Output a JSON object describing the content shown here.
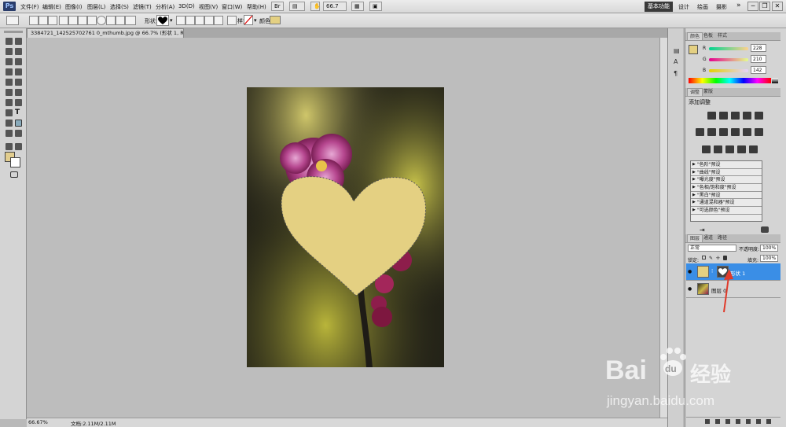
{
  "app": {
    "logo": "Ps"
  },
  "menu": {
    "items": [
      "文件(F)",
      "编辑(E)",
      "图像(I)",
      "图层(L)",
      "选择(S)",
      "滤镜(T)",
      "分析(A)",
      "3D(D)",
      "视图(V)",
      "窗口(W)",
      "帮助(H)"
    ],
    "zoom_value": "66.7"
  },
  "workspace": {
    "active": "基本功能",
    "links": [
      "设计",
      "绘画",
      "摄影"
    ],
    "more": "»",
    "window_controls": [
      "─",
      "❐",
      "✕"
    ]
  },
  "options": {
    "shape_label": "形状:",
    "shape_icon": "heart-shape",
    "style_label": "样式:",
    "color_label": "颜色:",
    "color_value": "#e4d082"
  },
  "document": {
    "tab_title": "3384721_142525702761 0_mthumb.jpg @ 66.7% (形状 1, RGB/8) *",
    "close": "×",
    "zoom": "66.67%",
    "size": "文档:2.11M/2.11M"
  },
  "tools": {
    "foreground": "#e2cd8e",
    "background": "#ffffff"
  },
  "color_panel": {
    "tabs": [
      "颜色",
      "色板",
      "样式"
    ],
    "swatch": "#e4d082",
    "channels": [
      {
        "label": "R",
        "value": "228"
      },
      {
        "label": "G",
        "value": "210"
      },
      {
        "label": "B",
        "value": "142"
      }
    ]
  },
  "adjustments_panel": {
    "tabs": [
      "调整",
      "蒙版"
    ],
    "title": "添加调整",
    "presets": [
      "\"色阶\"预设",
      "\"曲线\"预设",
      "\"曝光度\"预设",
      "\"色相/饱和度\"预设",
      "\"黑白\"预设",
      "\"通道混和器\"预设",
      "\"可选颜色\"预设"
    ]
  },
  "layers_panel": {
    "tabs": [
      "图层",
      "通道",
      "路径"
    ],
    "blend_mode": "正常",
    "opacity_label": "不透明度:",
    "opacity_value": "100%",
    "lock_label": "锁定:",
    "fill_label": "填充:",
    "fill_value": "100%",
    "layers": [
      {
        "name": "形状 1",
        "selected": true
      },
      {
        "name": "图层 0",
        "selected": false
      }
    ]
  },
  "watermark": {
    "brand": "Bai",
    "paw": "du",
    "cn": "经验",
    "url": "jingyan.baidu.com"
  },
  "colors": {
    "heart": "#e4d082",
    "selection": "#3a8ee6",
    "arrow": "#e03a2a"
  }
}
